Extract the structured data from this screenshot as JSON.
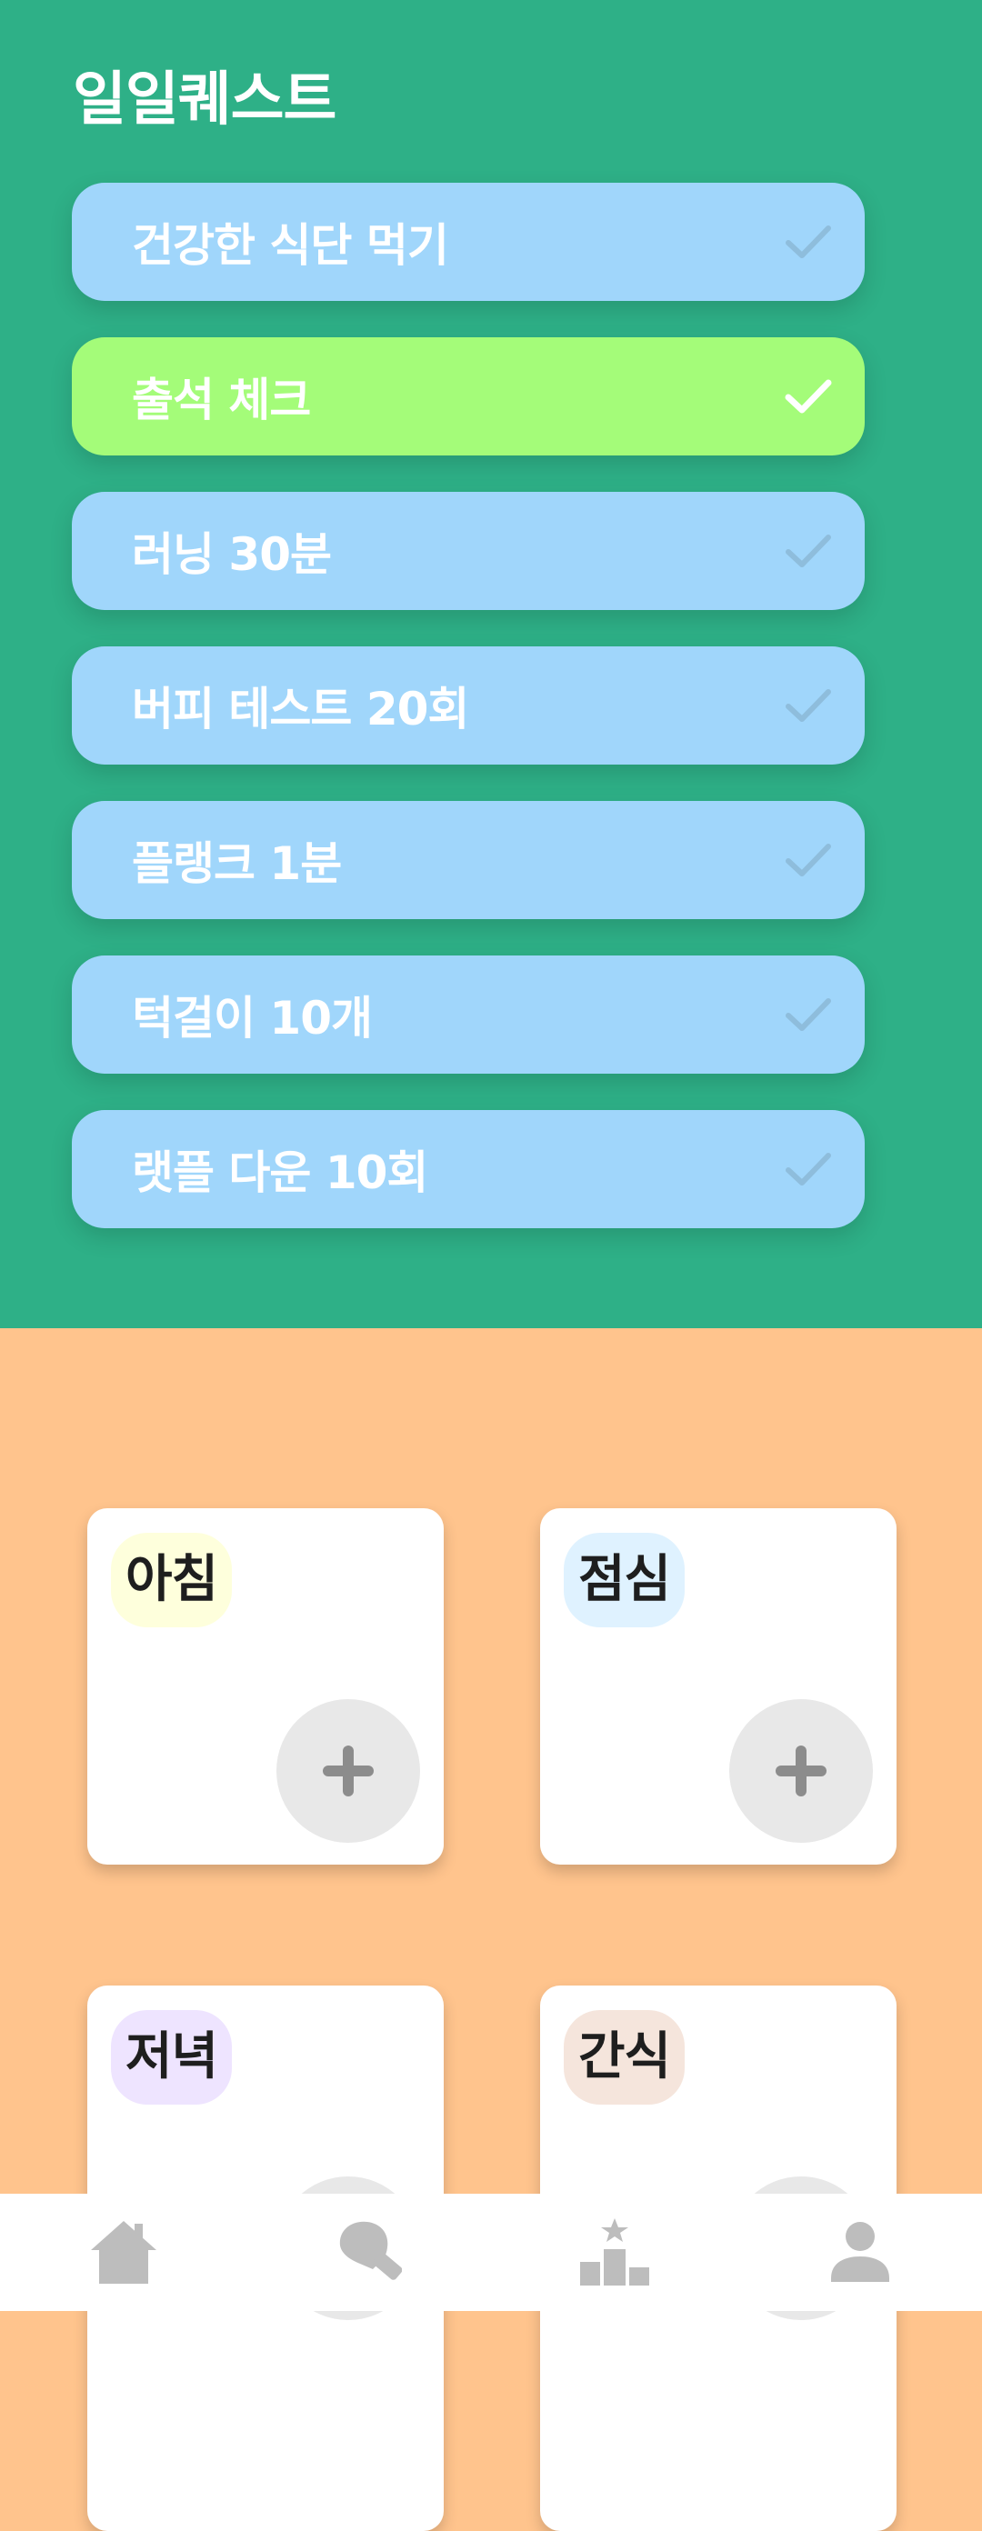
{
  "daily_quest": {
    "title": "일일퀘스트",
    "items": [
      {
        "label": "건강한 식단 먹기",
        "done": false
      },
      {
        "label": "출석 체크",
        "done": true
      },
      {
        "label": "러닝 30분",
        "done": false
      },
      {
        "label": "버피 테스트 20회",
        "done": false
      },
      {
        "label": "플랭크 1분",
        "done": false
      },
      {
        "label": "턱걸이 10개",
        "done": false
      },
      {
        "label": "랫플 다운 10회",
        "done": false
      }
    ]
  },
  "meals": [
    {
      "label": "아침",
      "tag_color": "#FEFFDC",
      "add_icon": "plus-icon"
    },
    {
      "label": "점심",
      "tag_color": "#DFF2FF",
      "add_icon": "plus-icon"
    },
    {
      "label": "저녁",
      "tag_color": "#EEE4FF",
      "add_icon": "plus-icon"
    },
    {
      "label": "간식",
      "tag_color": "#F5E5DC",
      "add_icon": "plus-icon"
    }
  ],
  "bottom_nav": [
    {
      "icon": "home-icon"
    },
    {
      "icon": "boxing-glove-icon"
    },
    {
      "icon": "leaderboard-icon"
    },
    {
      "icon": "profile-icon"
    }
  ],
  "colors": {
    "top_background": "#2EB087",
    "bottom_background": "#FFC48D",
    "quest_pending": "#A0D6FB",
    "quest_done": "#A4FC79",
    "nav_icon": "#BDBDBD"
  }
}
